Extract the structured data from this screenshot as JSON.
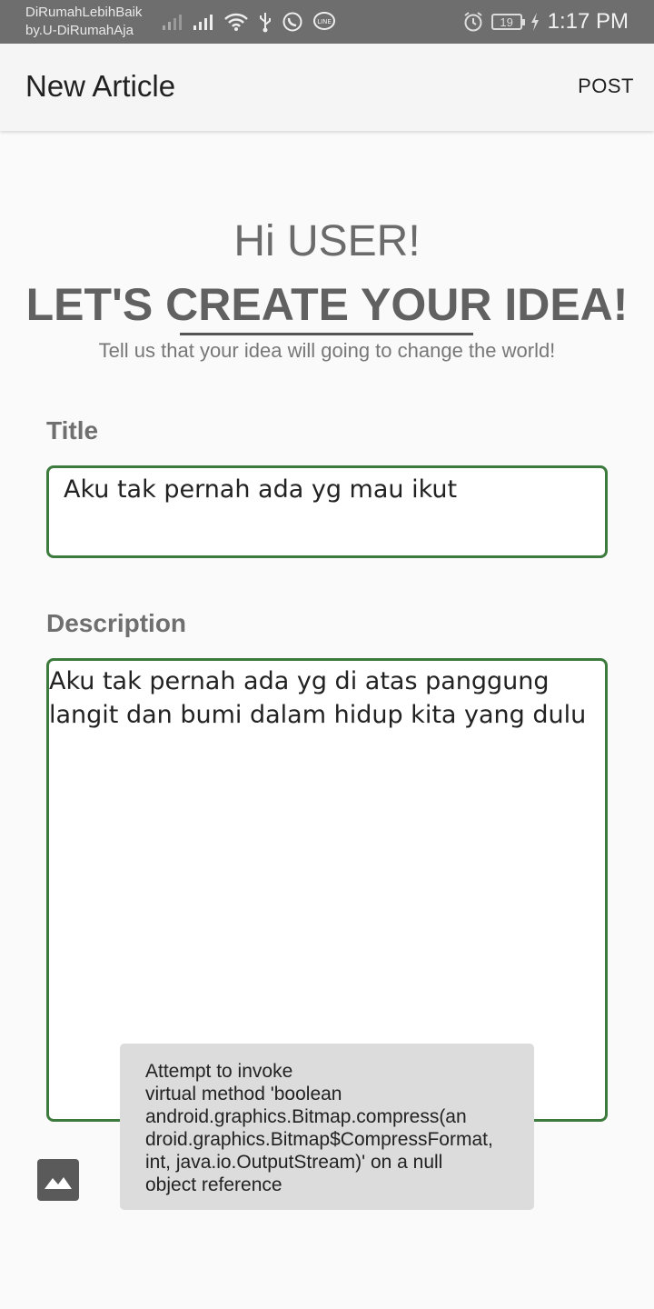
{
  "status_bar": {
    "carrier_line1": "DiRumahLebihBaik",
    "carrier_line2": "by.U-DiRumahAja",
    "battery": "19",
    "time": "1:17 PM",
    "icons": [
      "signal-weak-icon",
      "signal-icon",
      "wifi-icon",
      "usb-icon",
      "whatsapp-icon",
      "line-icon",
      "alarm-icon",
      "battery-icon",
      "charging-icon"
    ]
  },
  "appbar": {
    "title": "New Article",
    "post_label": "POST"
  },
  "hero": {
    "greeting": "Hi USER!",
    "headline": "LET'S CREATE YOUR IDEA!",
    "tagline": "Tell us that your idea will going to change the world!"
  },
  "form": {
    "title_label": "Title",
    "title_value": "Aku tak pernah ada yg mau ikut",
    "description_label": "Description",
    "description_value": "Aku tak pernah ada yg di atas panggung langit dan bumi dalam hidup kita yang dulu",
    "image_button_icon": "image-icon"
  },
  "toast": {
    "lines": [
      "Attempt to invoke",
      "virtual method 'boolean",
      "android.graphics.Bitmap.compress(an",
      "droid.graphics.Bitmap$CompressFormat,",
      "int, java.io.OutputStream)' on a null",
      "object reference"
    ]
  },
  "colors": {
    "status_bar": "#6e6e6e",
    "field_border": "#3d7a3d",
    "toast_bg": "#dcdcdc"
  }
}
